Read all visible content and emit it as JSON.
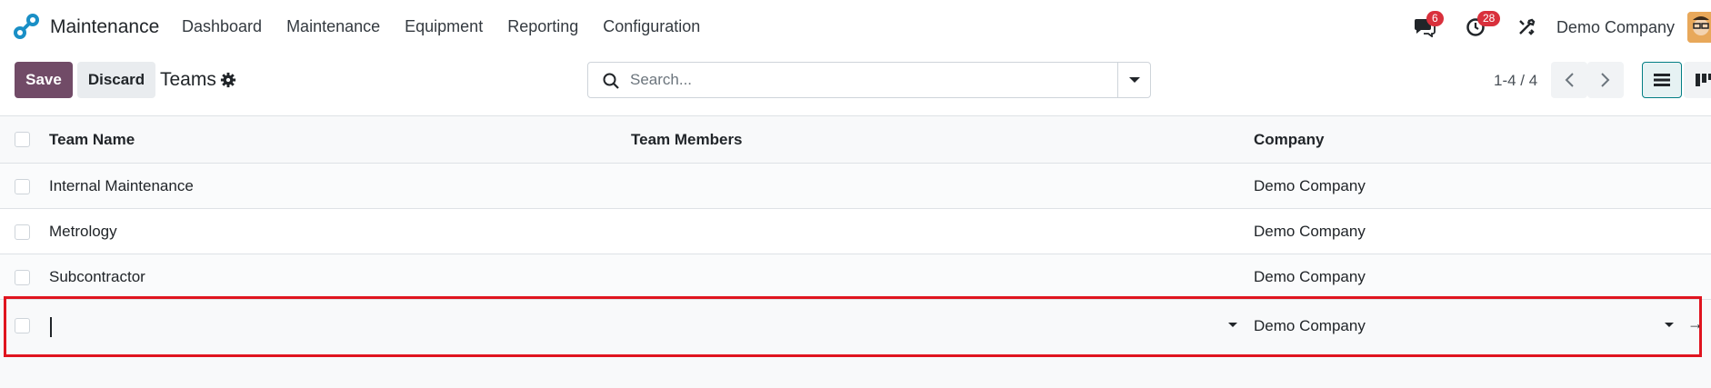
{
  "navbar": {
    "app_name": "Maintenance",
    "menu": [
      "Dashboard",
      "Maintenance",
      "Equipment",
      "Reporting",
      "Configuration"
    ],
    "messages_count": "6",
    "activities_count": "28",
    "company": "Demo Company"
  },
  "control_panel": {
    "save_label": "Save",
    "discard_label": "Discard",
    "title": "Teams",
    "search_placeholder": "Search...",
    "pager": "1-4 / 4"
  },
  "table": {
    "columns": [
      "Team Name",
      "Team Members",
      "Company"
    ],
    "rows": [
      {
        "name": "Internal Maintenance",
        "members": "",
        "company": "Demo Company"
      },
      {
        "name": "Metrology",
        "members": "",
        "company": "Demo Company"
      },
      {
        "name": "Subcontractor",
        "members": "",
        "company": "Demo Company"
      }
    ],
    "edit_row": {
      "name": "",
      "members": "",
      "company": "Demo Company"
    }
  },
  "colors": {
    "brand": "#714b67",
    "accent": "#017e84",
    "badge": "#d9303c",
    "highlight": "#e0141f"
  },
  "icons": [
    "app-logo-icon",
    "chat-icon",
    "clock-icon",
    "tools-icon",
    "gear-icon",
    "search-icon",
    "caret-down-icon",
    "chevron-left-icon",
    "chevron-right-icon",
    "list-view-icon",
    "kanban-view-icon",
    "arrow-right-icon"
  ]
}
